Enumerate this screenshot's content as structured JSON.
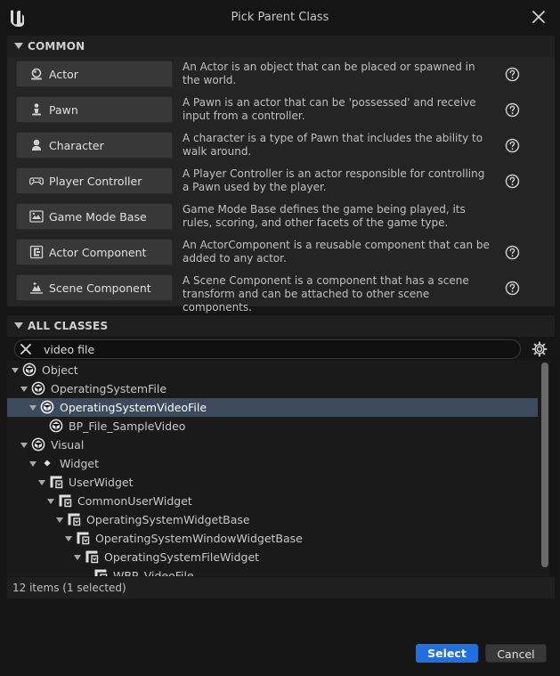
{
  "window": {
    "title": "Pick Parent Class"
  },
  "common": {
    "header": "COMMON",
    "classes": [
      {
        "label": "Actor",
        "description": "An Actor is an object that can be placed or spawned in the world.",
        "icon": "actor-icon"
      },
      {
        "label": "Pawn",
        "description": "A Pawn is an actor that can be 'possessed' and receive input from a controller.",
        "icon": "pawn-icon"
      },
      {
        "label": "Character",
        "description": "A character is a type of Pawn that includes the ability to walk around.",
        "icon": "character-icon"
      },
      {
        "label": "Player Controller",
        "description": "A Player Controller is an actor responsible for controlling a Pawn used by the player.",
        "icon": "gamepad-icon"
      },
      {
        "label": "Game Mode Base",
        "description": "Game Mode Base defines the game being played, its rules, scoring, and other facets of the game type.",
        "icon": "game-mode-icon"
      },
      {
        "label": "Actor Component",
        "description": "An ActorComponent is a reusable component that can be added to any actor.",
        "icon": "actor-component-icon"
      },
      {
        "label": "Scene Component",
        "description": "A Scene Component is a component that has a scene transform and can be attached to other scene components.",
        "icon": "scene-component-icon"
      }
    ]
  },
  "all_classes": {
    "header": "ALL CLASSES",
    "search": {
      "value": "video file"
    },
    "tree": [
      {
        "label": "Object",
        "depth": 0,
        "icon": "object-icon",
        "expanded": true
      },
      {
        "label": "OperatingSystemFile",
        "depth": 1,
        "icon": "object-icon",
        "expanded": true
      },
      {
        "label": "OperatingSystemVideoFile",
        "depth": 2,
        "icon": "object-icon",
        "expanded": true,
        "selected": true
      },
      {
        "label": "BP_File_SampleVideo",
        "depth": 3,
        "icon": "object-icon",
        "expanded": false
      },
      {
        "label": "Visual",
        "depth": 1,
        "icon": "object-icon",
        "expanded": true
      },
      {
        "label": "Widget",
        "depth": 2,
        "icon": "diamond-icon",
        "expanded": true
      },
      {
        "label": "UserWidget",
        "depth": 3,
        "icon": "widget-icon",
        "expanded": true
      },
      {
        "label": "CommonUserWidget",
        "depth": 4,
        "icon": "widget-icon",
        "expanded": true
      },
      {
        "label": "OperatingSystemWidgetBase",
        "depth": 5,
        "icon": "widget-icon",
        "expanded": true
      },
      {
        "label": "OperatingSystemWindowWidgetBase",
        "depth": 6,
        "icon": "widget-icon",
        "expanded": true
      },
      {
        "label": "OperatingSystemFileWidget",
        "depth": 7,
        "icon": "widget-icon",
        "expanded": true
      },
      {
        "label": "WBP_VideoFile",
        "depth": 8,
        "icon": "widget-icon",
        "expanded": false
      }
    ],
    "status": "12 items (1 selected)"
  },
  "footer": {
    "select_label": "Select",
    "cancel_label": "Cancel"
  },
  "colors": {
    "accent": "#1f6fe0",
    "selected_row": "#3d4a5e",
    "panel": "#242424",
    "background": "#151515"
  }
}
